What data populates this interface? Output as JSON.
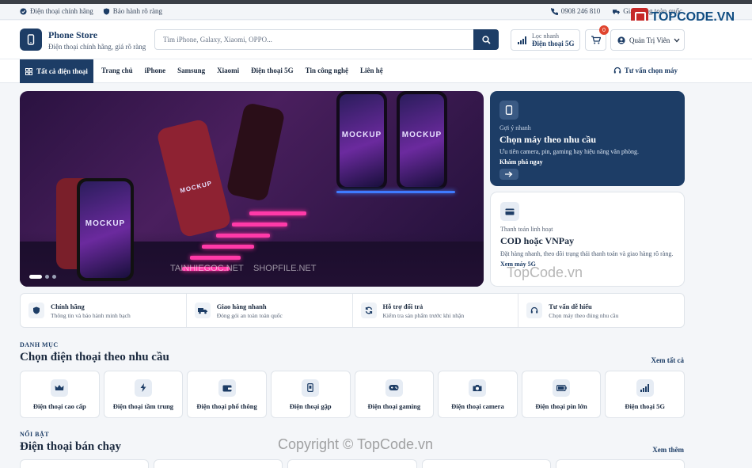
{
  "topbar": {
    "left": [
      {
        "icon": "check-circle-icon",
        "text": "Điện thoại chính hãng"
      },
      {
        "icon": "shield-icon",
        "text": "Bảo hành rõ ràng"
      }
    ],
    "phone": "0908 246 810",
    "shipping": "Giao hàng toàn quốc"
  },
  "header": {
    "brand_name": "Phone Store",
    "brand_tagline": "Điện thoại chính hãng, giá rõ ràng",
    "search_placeholder": "Tìm iPhone, Galaxy, Xiaomi, OPPO...",
    "filter_label": "Lọc nhanh",
    "filter_value": "Điện thoại 5G",
    "cart_count": "0",
    "user_name": "Quản Trị Viên"
  },
  "nav": {
    "all_label": "Tất cả điện thoại",
    "links": [
      "Trang chủ",
      "iPhone",
      "Samsung",
      "Xiaomi",
      "Điện thoại 5G",
      "Tin công nghệ",
      "Liên hệ"
    ],
    "advice": "Tư vấn chọn máy"
  },
  "hero": {
    "mockup_text": "MOCKUP",
    "watermark_1": "TAINHIEGOC.NET",
    "watermark_2": "SHOPFILE.NET"
  },
  "promo1": {
    "kicker": "Gợi ý nhanh",
    "title": "Chọn máy theo nhu cầu",
    "desc": "Ưu tiên camera, pin, gaming hay hiệu năng văn phòng.",
    "action": "Khám phá ngay"
  },
  "promo2": {
    "kicker": "Thanh toán linh hoạt",
    "title": "COD hoặc VNPay",
    "desc": "Đặt hàng nhanh, theo dõi trạng thái thanh toán và giao hàng rõ ràng.",
    "action": "Xem máy 5G"
  },
  "features": [
    {
      "title": "Chính hãng",
      "sub": "Thông tin và bảo hành minh bạch"
    },
    {
      "title": "Giao hàng nhanh",
      "sub": "Đóng gói an toàn toàn quốc"
    },
    {
      "title": "Hỗ trợ đổi trả",
      "sub": "Kiểm tra sản phẩm trước khi nhận"
    },
    {
      "title": "Tư vấn dễ hiểu",
      "sub": "Chọn máy theo đúng nhu cầu"
    }
  ],
  "categories_section": {
    "kicker": "DANH MỤC",
    "title": "Chọn điện thoại theo nhu cầu",
    "more": "Xem tất cả",
    "items": [
      "Điện thoại cao cấp",
      "Điện thoại tầm trung",
      "Điện thoại phổ thông",
      "Điện thoại gập",
      "Điện thoại gaming",
      "Điện thoại camera",
      "Điện thoại pin lớn",
      "Điện thoại 5G"
    ]
  },
  "bestseller_section": {
    "kicker": "NỔI BẬT",
    "title": "Điện thoại bán chạy",
    "more": "Xem thêm"
  },
  "watermarks": {
    "logo": "TOPCODE.VN",
    "overlay": "TopCode.vn",
    "copyright": "Copyright © TopCode.vn"
  },
  "colors": {
    "primary": "#1d3d66",
    "accent": "#e0452f",
    "background": "#f4f6f9"
  }
}
